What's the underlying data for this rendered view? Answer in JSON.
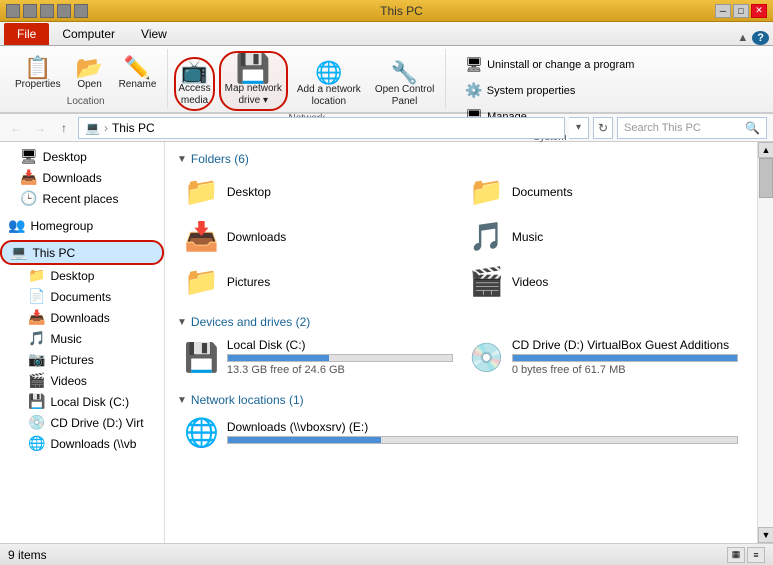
{
  "title_bar": {
    "title": "This PC",
    "min_label": "─",
    "max_label": "□",
    "close_label": "✕"
  },
  "ribbon": {
    "tabs": [
      "File",
      "Computer",
      "View"
    ],
    "active_tab": "Computer",
    "location_group": {
      "label": "Location",
      "buttons": [
        {
          "id": "properties",
          "label": "Properties",
          "icon": "📋"
        },
        {
          "id": "open",
          "label": "Open",
          "icon": "📂"
        },
        {
          "id": "rename",
          "label": "Rename",
          "icon": "✏️"
        }
      ]
    },
    "network_group": {
      "label": "Network",
      "buttons": [
        {
          "id": "access-media",
          "label": "Access\nmedia",
          "icon": "📺"
        },
        {
          "id": "map-network-drive",
          "label": "Map network\ndrive",
          "icon": "💾"
        },
        {
          "id": "add-network-location",
          "label": "Add a network\nlocation",
          "icon": "🌐"
        },
        {
          "id": "open-control-panel",
          "label": "Open Control\nPanel",
          "icon": "🔧"
        }
      ]
    },
    "system_group": {
      "label": "System",
      "buttons": [
        {
          "id": "uninstall",
          "label": "Uninstall or change a program",
          "icon": "🗑"
        },
        {
          "id": "system-properties",
          "label": "System properties",
          "icon": "⚙"
        },
        {
          "id": "manage",
          "label": "Manage",
          "icon": "🖥"
        }
      ]
    }
  },
  "address_bar": {
    "path": "This PC",
    "search_placeholder": "Search This PC",
    "refresh_icon": "↻",
    "back_icon": "←",
    "forward_icon": "→",
    "up_icon": "↑",
    "dropdown_icon": "▾",
    "search_icon": "🔍"
  },
  "sidebar": {
    "items": [
      {
        "id": "desktop",
        "label": "Desktop",
        "icon": "🖥",
        "indent": 1
      },
      {
        "id": "downloads",
        "label": "Downloads",
        "icon": "📥",
        "indent": 1
      },
      {
        "id": "recent-places",
        "label": "Recent places",
        "icon": "🕒",
        "indent": 1
      },
      {
        "id": "homegroup",
        "label": "Homegroup",
        "icon": "👥",
        "indent": 0
      },
      {
        "id": "this-pc",
        "label": "This PC",
        "icon": "💻",
        "indent": 0,
        "selected": true
      },
      {
        "id": "pc-desktop",
        "label": "Desktop",
        "icon": "📁",
        "indent": 2
      },
      {
        "id": "pc-documents",
        "label": "Documents",
        "icon": "📁",
        "indent": 2
      },
      {
        "id": "pc-downloads",
        "label": "Downloads",
        "icon": "📁",
        "indent": 2
      },
      {
        "id": "pc-music",
        "label": "Music",
        "icon": "🎵",
        "indent": 2
      },
      {
        "id": "pc-pictures",
        "label": "Pictures",
        "icon": "📁",
        "indent": 2
      },
      {
        "id": "pc-videos",
        "label": "Videos",
        "icon": "📁",
        "indent": 2
      },
      {
        "id": "local-disk",
        "label": "Local Disk (C:)",
        "icon": "💾",
        "indent": 2
      },
      {
        "id": "cd-drive",
        "label": "CD Drive (D:) Virt",
        "icon": "💿",
        "indent": 2
      },
      {
        "id": "downloads-net",
        "label": "Downloads (\\\\vb",
        "icon": "🌐",
        "indent": 2
      }
    ]
  },
  "content": {
    "folders_section": {
      "label": "Folders (6)",
      "items": [
        {
          "id": "desktop",
          "label": "Desktop",
          "icon": "📁"
        },
        {
          "id": "documents",
          "label": "Documents",
          "icon": "📁"
        },
        {
          "id": "downloads",
          "label": "Downloads",
          "icon": "📥"
        },
        {
          "id": "music",
          "label": "Music",
          "icon": "🎵"
        },
        {
          "id": "pictures",
          "label": "Pictures",
          "icon": "📁"
        },
        {
          "id": "videos",
          "label": "Videos",
          "icon": "🎬"
        }
      ]
    },
    "devices_section": {
      "label": "Devices and drives (2)",
      "items": [
        {
          "id": "local-disk",
          "name": "Local Disk (C:)",
          "icon": "💾",
          "used_pct": 45,
          "size_text": "13.3 GB free of 24.6 GB"
        },
        {
          "id": "cd-drive",
          "name": "CD Drive (D:) VirtualBox Guest Additions",
          "icon": "💿",
          "used_pct": 100,
          "size_text": "0 bytes free of 61.7 MB"
        }
      ]
    },
    "network_section": {
      "label": "Network locations (1)",
      "items": [
        {
          "id": "downloads-net",
          "name": "Downloads (\\\\vboxsrv) (E:)",
          "icon": "🌐",
          "used_pct": 30,
          "size_text": ""
        }
      ]
    }
  },
  "status_bar": {
    "count": "9 items",
    "view_icons": [
      "▦",
      "≡"
    ]
  }
}
